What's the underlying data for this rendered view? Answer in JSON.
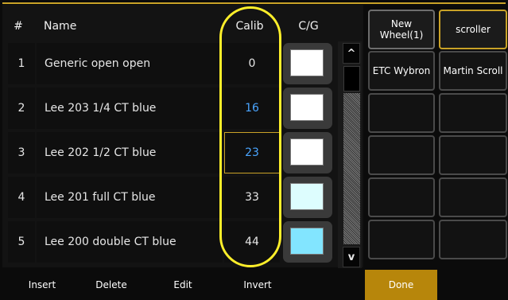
{
  "table": {
    "headers": {
      "num": "#",
      "name": "Name",
      "calib": "Calib",
      "cg": "C/G"
    },
    "rows": [
      {
        "num": "1",
        "name": "Generic open open",
        "calib": "0",
        "swatch_color": "#ffffff"
      },
      {
        "num": "2",
        "name": "Lee 203 1/4 CT blue",
        "calib": "16",
        "swatch_color": "#ffffff"
      },
      {
        "num": "3",
        "name": "Lee 202 1/2 CT blue",
        "calib": "23",
        "swatch_color": "#ffffff"
      },
      {
        "num": "4",
        "name": "Lee 201 full CT blue",
        "calib": "33",
        "swatch_color": "#ddfdfe"
      },
      {
        "num": "5",
        "name": "Lee 200 double CT blue",
        "calib": "44",
        "swatch_color": "#82e5ff"
      }
    ]
  },
  "scrollbar": {
    "up_glyph": "^",
    "down_glyph": "v"
  },
  "right_buttons": {
    "new_wheel": "New Wheel(1)",
    "scroller": "scroller",
    "etc_wybron": "ETC Wybron",
    "martin_scroll": "Martin Scroll"
  },
  "softkeys": {
    "insert": "Insert",
    "delete": "Delete",
    "edit": "Edit",
    "invert": "Invert",
    "done": "Done"
  },
  "colors": {
    "accent": "#c9a227",
    "highlight_text": "#4aa5ff",
    "done_bg": "#b7860b",
    "annotation": "#ffef2a"
  }
}
